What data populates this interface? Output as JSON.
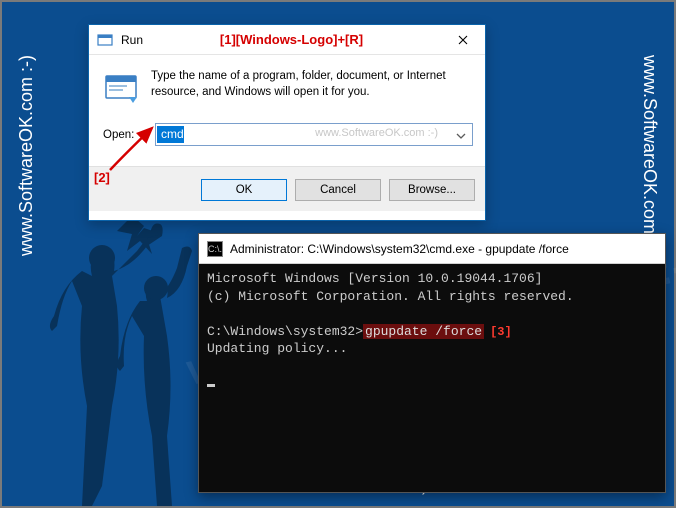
{
  "watermark": "www.SoftwareOK.com :-)",
  "annotations": {
    "title": "[1][Windows-Logo]+[R]",
    "label2": "[2]",
    "label3": "[3]"
  },
  "run_dialog": {
    "title": "Run",
    "description": "Type the name of a program, folder, document, or Internet resource, and Windows will open it for you.",
    "open_label": "Open:",
    "input_value": "cmd",
    "input_watermark": "www.SoftwareOK.com :-)",
    "buttons": {
      "ok": "OK",
      "cancel": "Cancel",
      "browse": "Browse..."
    }
  },
  "cmd_window": {
    "title": "Administrator: C:\\Windows\\system32\\cmd.exe - gpupdate  /force",
    "title_icon": "C:\\.",
    "line_version": "Microsoft Windows [Version 10.0.19044.1706]",
    "line_copyright": "(c) Microsoft Corporation. All rights reserved.",
    "prompt": "C:\\Windows\\system32>",
    "command": "gpupdate /force",
    "line_updating": "Updating policy..."
  }
}
